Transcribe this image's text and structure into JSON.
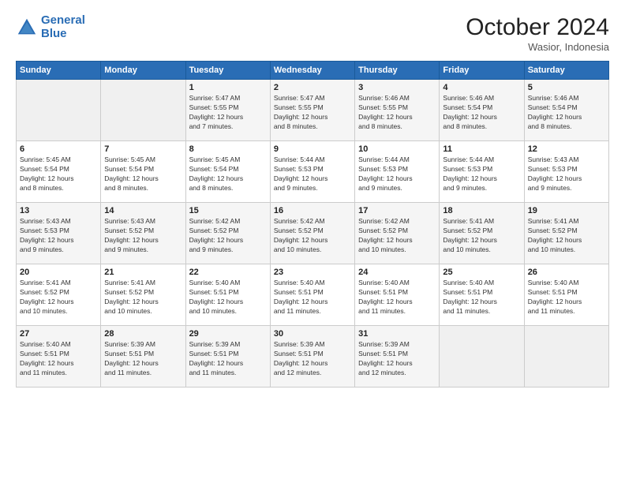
{
  "logo": {
    "line1": "General",
    "line2": "Blue"
  },
  "title": "October 2024",
  "location": "Wasior, Indonesia",
  "days_header": [
    "Sunday",
    "Monday",
    "Tuesday",
    "Wednesday",
    "Thursday",
    "Friday",
    "Saturday"
  ],
  "weeks": [
    [
      {
        "day": "",
        "info": ""
      },
      {
        "day": "",
        "info": ""
      },
      {
        "day": "1",
        "info": "Sunrise: 5:47 AM\nSunset: 5:55 PM\nDaylight: 12 hours\nand 7 minutes."
      },
      {
        "day": "2",
        "info": "Sunrise: 5:47 AM\nSunset: 5:55 PM\nDaylight: 12 hours\nand 8 minutes."
      },
      {
        "day": "3",
        "info": "Sunrise: 5:46 AM\nSunset: 5:55 PM\nDaylight: 12 hours\nand 8 minutes."
      },
      {
        "day": "4",
        "info": "Sunrise: 5:46 AM\nSunset: 5:54 PM\nDaylight: 12 hours\nand 8 minutes."
      },
      {
        "day": "5",
        "info": "Sunrise: 5:46 AM\nSunset: 5:54 PM\nDaylight: 12 hours\nand 8 minutes."
      }
    ],
    [
      {
        "day": "6",
        "info": "Sunrise: 5:45 AM\nSunset: 5:54 PM\nDaylight: 12 hours\nand 8 minutes."
      },
      {
        "day": "7",
        "info": "Sunrise: 5:45 AM\nSunset: 5:54 PM\nDaylight: 12 hours\nand 8 minutes."
      },
      {
        "day": "8",
        "info": "Sunrise: 5:45 AM\nSunset: 5:54 PM\nDaylight: 12 hours\nand 8 minutes."
      },
      {
        "day": "9",
        "info": "Sunrise: 5:44 AM\nSunset: 5:53 PM\nDaylight: 12 hours\nand 9 minutes."
      },
      {
        "day": "10",
        "info": "Sunrise: 5:44 AM\nSunset: 5:53 PM\nDaylight: 12 hours\nand 9 minutes."
      },
      {
        "day": "11",
        "info": "Sunrise: 5:44 AM\nSunset: 5:53 PM\nDaylight: 12 hours\nand 9 minutes."
      },
      {
        "day": "12",
        "info": "Sunrise: 5:43 AM\nSunset: 5:53 PM\nDaylight: 12 hours\nand 9 minutes."
      }
    ],
    [
      {
        "day": "13",
        "info": "Sunrise: 5:43 AM\nSunset: 5:53 PM\nDaylight: 12 hours\nand 9 minutes."
      },
      {
        "day": "14",
        "info": "Sunrise: 5:43 AM\nSunset: 5:52 PM\nDaylight: 12 hours\nand 9 minutes."
      },
      {
        "day": "15",
        "info": "Sunrise: 5:42 AM\nSunset: 5:52 PM\nDaylight: 12 hours\nand 9 minutes."
      },
      {
        "day": "16",
        "info": "Sunrise: 5:42 AM\nSunset: 5:52 PM\nDaylight: 12 hours\nand 10 minutes."
      },
      {
        "day": "17",
        "info": "Sunrise: 5:42 AM\nSunset: 5:52 PM\nDaylight: 12 hours\nand 10 minutes."
      },
      {
        "day": "18",
        "info": "Sunrise: 5:41 AM\nSunset: 5:52 PM\nDaylight: 12 hours\nand 10 minutes."
      },
      {
        "day": "19",
        "info": "Sunrise: 5:41 AM\nSunset: 5:52 PM\nDaylight: 12 hours\nand 10 minutes."
      }
    ],
    [
      {
        "day": "20",
        "info": "Sunrise: 5:41 AM\nSunset: 5:52 PM\nDaylight: 12 hours\nand 10 minutes."
      },
      {
        "day": "21",
        "info": "Sunrise: 5:41 AM\nSunset: 5:52 PM\nDaylight: 12 hours\nand 10 minutes."
      },
      {
        "day": "22",
        "info": "Sunrise: 5:40 AM\nSunset: 5:51 PM\nDaylight: 12 hours\nand 10 minutes."
      },
      {
        "day": "23",
        "info": "Sunrise: 5:40 AM\nSunset: 5:51 PM\nDaylight: 12 hours\nand 11 minutes."
      },
      {
        "day": "24",
        "info": "Sunrise: 5:40 AM\nSunset: 5:51 PM\nDaylight: 12 hours\nand 11 minutes."
      },
      {
        "day": "25",
        "info": "Sunrise: 5:40 AM\nSunset: 5:51 PM\nDaylight: 12 hours\nand 11 minutes."
      },
      {
        "day": "26",
        "info": "Sunrise: 5:40 AM\nSunset: 5:51 PM\nDaylight: 12 hours\nand 11 minutes."
      }
    ],
    [
      {
        "day": "27",
        "info": "Sunrise: 5:40 AM\nSunset: 5:51 PM\nDaylight: 12 hours\nand 11 minutes."
      },
      {
        "day": "28",
        "info": "Sunrise: 5:39 AM\nSunset: 5:51 PM\nDaylight: 12 hours\nand 11 minutes."
      },
      {
        "day": "29",
        "info": "Sunrise: 5:39 AM\nSunset: 5:51 PM\nDaylight: 12 hours\nand 11 minutes."
      },
      {
        "day": "30",
        "info": "Sunrise: 5:39 AM\nSunset: 5:51 PM\nDaylight: 12 hours\nand 12 minutes."
      },
      {
        "day": "31",
        "info": "Sunrise: 5:39 AM\nSunset: 5:51 PM\nDaylight: 12 hours\nand 12 minutes."
      },
      {
        "day": "",
        "info": ""
      },
      {
        "day": "",
        "info": ""
      }
    ]
  ]
}
